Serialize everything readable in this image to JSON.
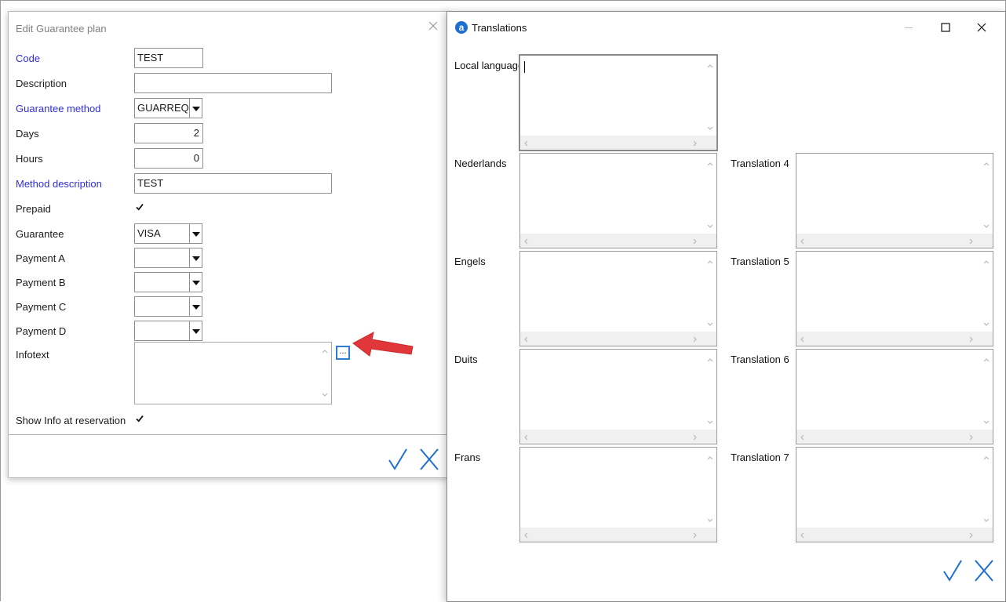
{
  "edit_dialog": {
    "title": "Edit Guarantee plan",
    "fields": {
      "code": {
        "label": "Code",
        "value": "TEST"
      },
      "description": {
        "label": "Description",
        "value": ""
      },
      "guarantee_method": {
        "label": "Guarantee method",
        "value": "GUARREQ"
      },
      "days": {
        "label": "Days",
        "value": "2"
      },
      "hours": {
        "label": "Hours",
        "value": "0"
      },
      "method_description": {
        "label": "Method description",
        "value": "TEST"
      },
      "prepaid": {
        "label": "Prepaid",
        "checked": true
      },
      "guarantee": {
        "label": "Guarantee",
        "value": "VISA"
      },
      "payment_a": {
        "label": "Payment A",
        "value": ""
      },
      "payment_b": {
        "label": "Payment B",
        "value": ""
      },
      "payment_c": {
        "label": "Payment C",
        "value": ""
      },
      "payment_d": {
        "label": "Payment D",
        "value": ""
      },
      "infotext": {
        "label": "Infotext",
        "value": "",
        "button_label": "..."
      },
      "show_info": {
        "label": "Show Info at reservation",
        "checked": true
      }
    },
    "required_color": "#2f2fd8"
  },
  "translations_window": {
    "title": "Translations",
    "icon_letter": "a",
    "left_column": [
      {
        "label": "Local language",
        "value": ""
      },
      {
        "label": "Nederlands",
        "value": ""
      },
      {
        "label": "Engels",
        "value": ""
      },
      {
        "label": "Duits",
        "value": ""
      },
      {
        "label": "Frans",
        "value": ""
      }
    ],
    "right_column": [
      {
        "label": "Translation 4",
        "value": ""
      },
      {
        "label": "Translation 5",
        "value": ""
      },
      {
        "label": "Translation 6",
        "value": ""
      },
      {
        "label": "Translation 7",
        "value": ""
      }
    ],
    "accent_color": "#1f6fd0"
  },
  "annotation": {
    "arrow_color": "#e0383a"
  }
}
